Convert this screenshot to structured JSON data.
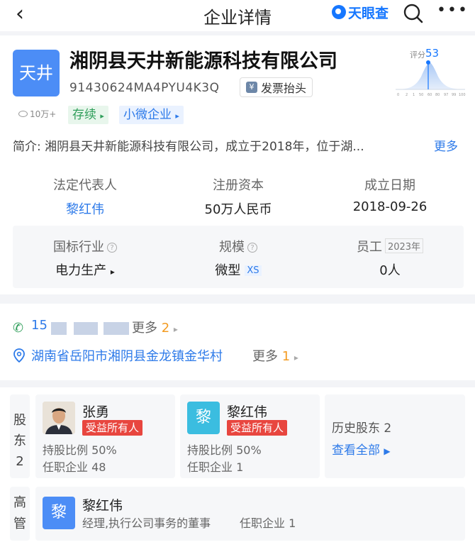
{
  "header": {
    "title": "企业详情",
    "brand": "天眼查",
    "back_icon": "chevron-left-icon",
    "search_icon": "search-icon",
    "more_icon": "more-dots-icon",
    "brand_color": "#1677ff"
  },
  "company": {
    "logo_text": "天井",
    "name": "湘阴县天井新能源科技有限公司",
    "credit_code": "91430624MA4PYU4K3Q",
    "invoice_label": "发票抬头",
    "invoice_icon": "¥",
    "score_label": "评分",
    "score_value": "53",
    "score_ticks": [
      "0",
      "2",
      "1",
      "50",
      "60",
      "80",
      "97",
      "99",
      "100"
    ],
    "views": "10万+",
    "status_tag": "存续",
    "size_tag": "小微企业",
    "intro_label": "简介:",
    "intro_text": "湘阴县天井新能源科技有限公司，成立于2018年，位于湖...",
    "intro_more": "更多"
  },
  "facts": {
    "legal_rep_label": "法定代表人",
    "legal_rep_value": "黎红伟",
    "capital_label": "注册资本",
    "capital_value": "50万人民币",
    "founded_label": "成立日期",
    "founded_value": "2018-09-26",
    "industry_label": "国标行业",
    "industry_value": "电力生产",
    "scale_label": "规模",
    "scale_value": "微型",
    "scale_badge": "XS",
    "staff_label": "员工",
    "staff_year": "2023年",
    "staff_value": "0人"
  },
  "contact": {
    "phone_prefix": "15",
    "phone_more": "更多",
    "phone_count": "2",
    "address": "湖南省岳阳市湘阴县金龙镇金华村",
    "address_more": "更多",
    "address_count": "1"
  },
  "shareholders": {
    "side_label": [
      "股",
      "东",
      "2"
    ],
    "items": [
      {
        "name": "张勇",
        "tag": "受益所有人",
        "ratio": "持股比例 50%",
        "companies": "任职企业 48"
      },
      {
        "name": "黎红伟",
        "avatar_letter": "黎",
        "tag": "受益所有人",
        "ratio": "持股比例 50%",
        "companies": "任职企业 1"
      }
    ],
    "history_label": "历史股东",
    "history_count": "2",
    "view_all": "查看全部"
  },
  "managers": {
    "side_label": [
      "高",
      "管"
    ],
    "items": [
      {
        "avatar_letter": "黎",
        "name": "黎红伟",
        "role": "经理,执行公司事务的董事",
        "companies": "任职企业 1"
      }
    ]
  }
}
